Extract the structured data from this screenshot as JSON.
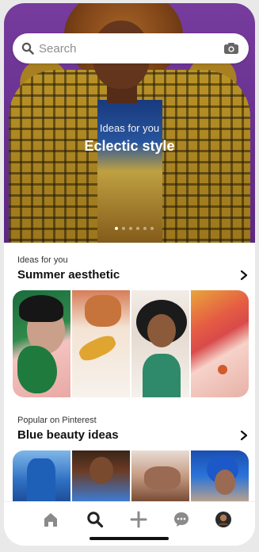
{
  "search": {
    "placeholder": "Search"
  },
  "hero": {
    "kicker": "Ideas for you",
    "title": "Eclectic style"
  },
  "sections": [
    {
      "kicker": "Ideas for you",
      "title": "Summer aesthetic"
    },
    {
      "kicker": "Popular on Pinterest",
      "title": "Blue beauty ideas"
    }
  ],
  "nav": {
    "items": [
      {
        "icon": "home-icon"
      },
      {
        "icon": "search-icon",
        "selected": true
      },
      {
        "icon": "plus-icon"
      },
      {
        "icon": "chat-icon"
      },
      {
        "icon": "profile-avatar"
      }
    ]
  },
  "colors": {
    "accent": "#111111",
    "hero_bg": "#7d3fa6"
  }
}
